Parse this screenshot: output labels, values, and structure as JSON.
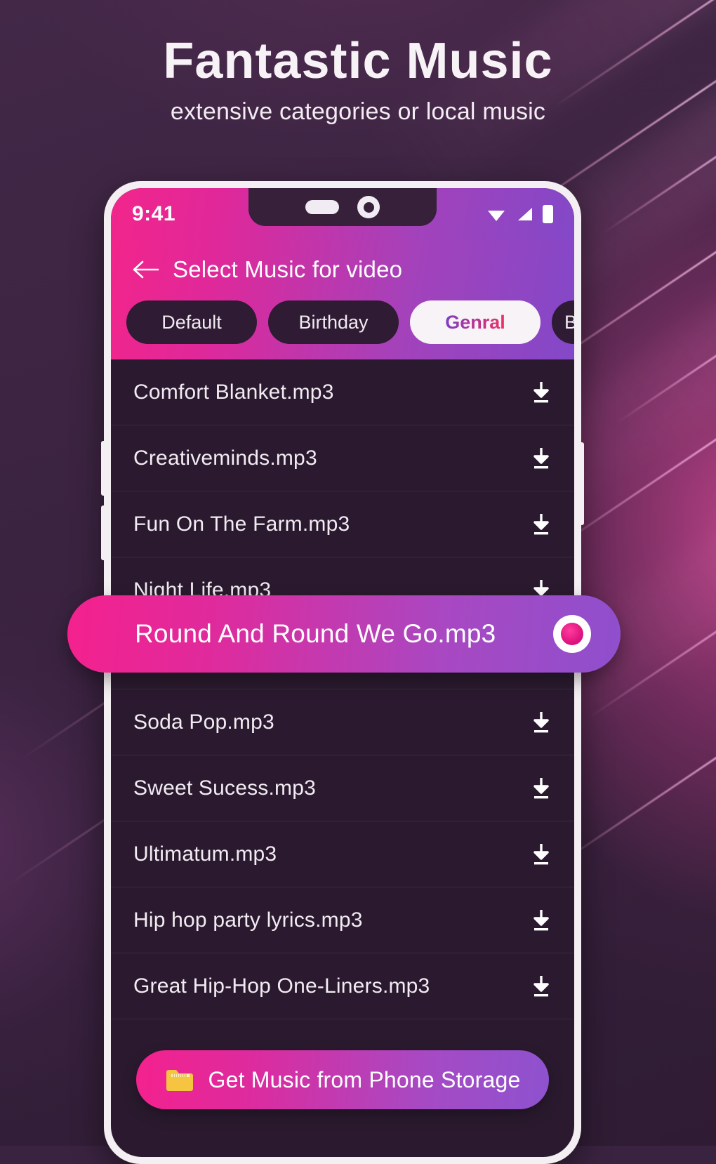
{
  "promo": {
    "headline": "Fantastic Music",
    "subhead": "extensive categories or local music"
  },
  "colors": {
    "background": "#3a2340",
    "accent_pink": "#f2258b",
    "accent_purple": "#8348c8",
    "list_background": "#2b1a2f",
    "folder_icon": "#f5c542"
  },
  "phone": {
    "statusbar": {
      "clock": "9:41",
      "icons": [
        "wifi-icon",
        "signal-icon",
        "battery-icon"
      ]
    },
    "appbar": {
      "back_icon": "back-arrow-icon",
      "title": "Select Music for video"
    },
    "tabs": [
      {
        "label": "Default",
        "active": false
      },
      {
        "label": "Birthday",
        "active": false
      },
      {
        "label": "Genral",
        "active": true
      },
      {
        "label": "B",
        "active": false
      }
    ],
    "tracks": [
      {
        "name": "Comfort Blanket.mp3",
        "action_icon": "download-icon",
        "selected": false
      },
      {
        "name": "Creativeminds.mp3",
        "action_icon": "download-icon",
        "selected": false
      },
      {
        "name": "Fun On The Farm.mp3",
        "action_icon": "download-icon",
        "selected": false
      },
      {
        "name": "Night Life.mp3",
        "action_icon": "download-icon",
        "selected": false
      },
      {
        "name": "Round And Round We Go.mp3",
        "action_icon": "radio-selected-icon",
        "selected": true
      },
      {
        "name": "Soda Pop.mp3",
        "action_icon": "download-icon",
        "selected": false
      },
      {
        "name": "Sweet Sucess.mp3",
        "action_icon": "download-icon",
        "selected": false
      },
      {
        "name": "Ultimatum.mp3",
        "action_icon": "download-icon",
        "selected": false
      },
      {
        "name": "Hip hop party lyrics.mp3",
        "action_icon": "download-icon",
        "selected": false
      },
      {
        "name": "Great Hip-Hop One-Liners.mp3",
        "action_icon": "download-icon",
        "selected": false
      }
    ],
    "cta": {
      "icon": "folder-icon",
      "label": "Get Music from Phone Storage"
    }
  }
}
